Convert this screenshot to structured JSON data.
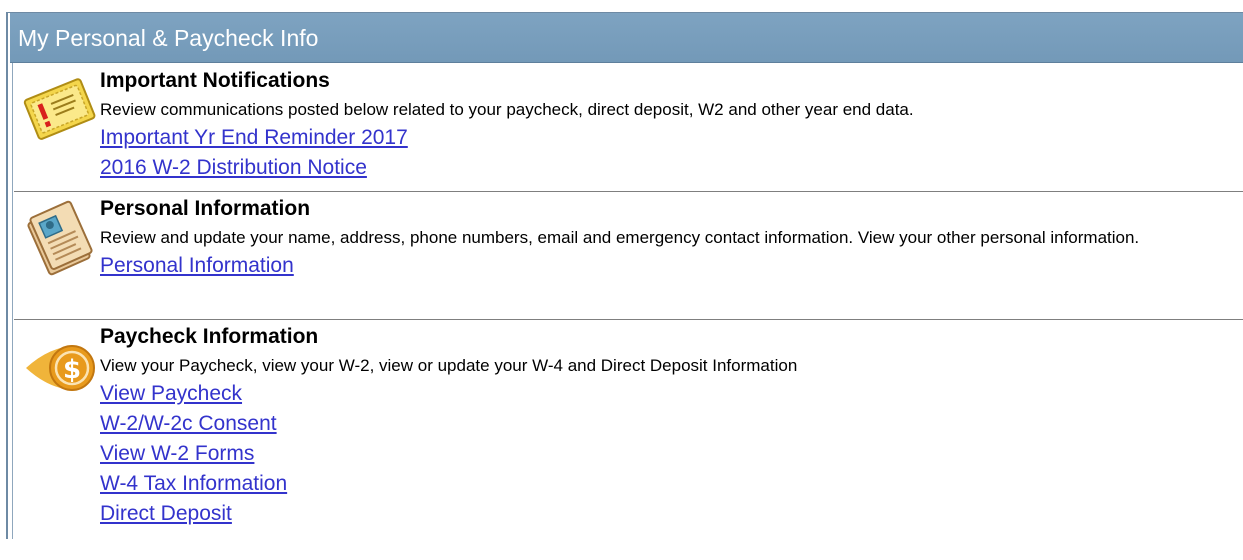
{
  "header": {
    "title": "My Personal & Paycheck Info"
  },
  "sections": [
    {
      "title": "Important Notifications",
      "icon": "notification-certificate-icon",
      "description": "Review communications posted below related to your paycheck, direct deposit, W2 and other year end data.",
      "links": [
        "Important Yr End Reminder 2017",
        "2016 W-2 Distribution Notice"
      ]
    },
    {
      "title": "Personal Information",
      "icon": "personal-folder-icon",
      "description": "Review and update your name, address, phone numbers, email and emergency contact information. View your other personal information.",
      "links": [
        "Personal Information"
      ]
    },
    {
      "title": "Paycheck Information",
      "icon": "dollar-coin-icon",
      "description": "View your Paycheck, view your W-2, view or update your W-4 and Direct Deposit Information",
      "links": [
        "View Paycheck",
        "W-2/W-2c Consent",
        "View W-2 Forms",
        "W-4 Tax Information",
        "Direct Deposit"
      ]
    }
  ],
  "colors": {
    "header_bg": "#7ea3c1",
    "link": "#3333cc",
    "frame_border": "#6e8aa4"
  }
}
